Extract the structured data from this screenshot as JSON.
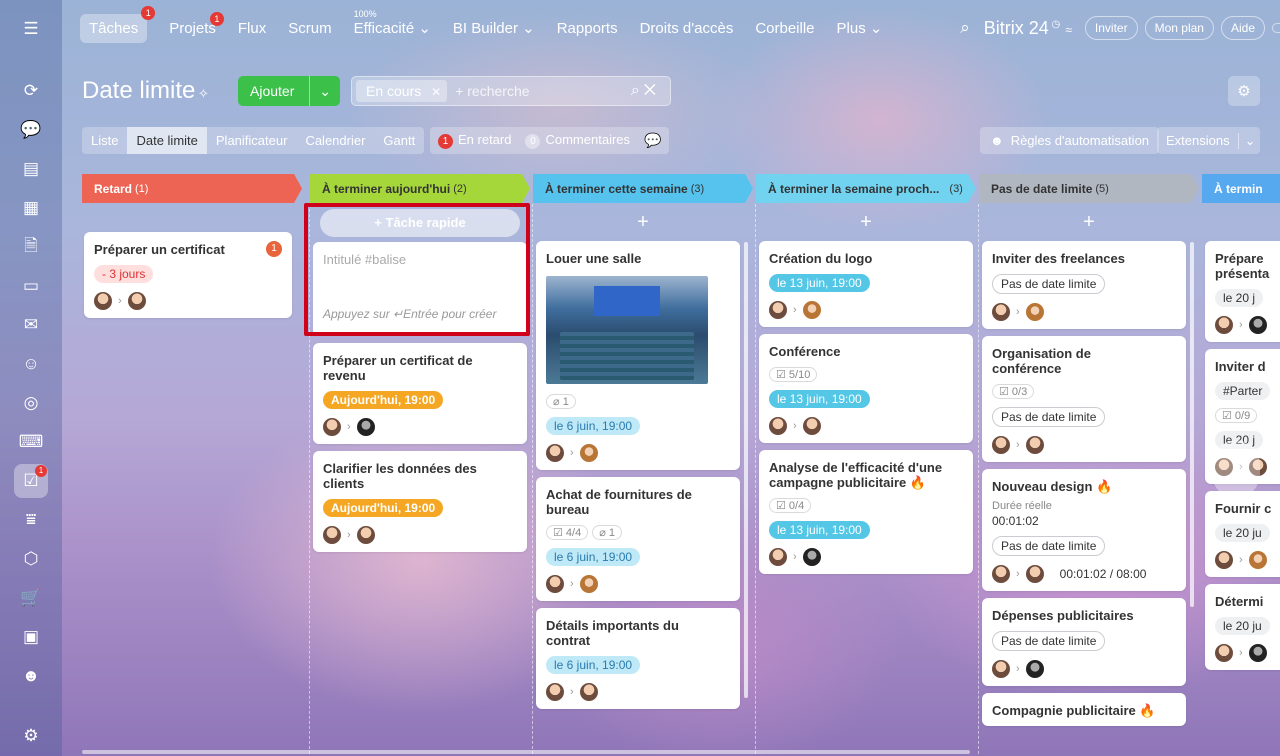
{
  "colors": {
    "accent_green": "#3bc04a",
    "overdue": "#ee6454",
    "today": "#a5d63a",
    "week": "#56c3ef",
    "nextweek": "#72d3f0",
    "nodeadline": "#b0b7c0",
    "badge_red": "#e53935",
    "highlight": "#d0021b"
  },
  "sidebar": {
    "icons": [
      "menu-icon",
      "feed-icon",
      "chat-icon",
      "docs-icon",
      "calendar-icon",
      "files-icon",
      "drive-icon",
      "mail-icon",
      "groups-icon",
      "target-icon",
      "crm-icon",
      "tasks-icon",
      "filter-icon",
      "box-icon",
      "cart-icon",
      "contact-icon",
      "robot-icon",
      "settings-icon"
    ],
    "tasks_badge": "1"
  },
  "topnav": {
    "items": [
      {
        "label": "Tâches",
        "badge": "1",
        "active": true
      },
      {
        "label": "Projets",
        "badge": "1"
      },
      {
        "label": "Flux"
      },
      {
        "label": "Scrum"
      },
      {
        "label": "Efficacité",
        "sup": "100%",
        "dropdown": true
      },
      {
        "label": "BI Builder",
        "dropdown": true
      },
      {
        "label": "Rapports"
      },
      {
        "label": "Droits d'accès"
      },
      {
        "label": "Corbeille"
      },
      {
        "label": "Plus",
        "dropdown": true
      }
    ],
    "brand": "Bitrix 24",
    "invite": "Inviter",
    "plan": "Mon plan",
    "help": "Aide"
  },
  "header": {
    "title": "Date limite",
    "add_label": "Ajouter",
    "filter_chip": "En cours",
    "search_placeholder": "+ recherche"
  },
  "views": {
    "items": [
      "Liste",
      "Date limite",
      "Planificateur",
      "Calendrier",
      "Gantt"
    ],
    "active": "Date limite"
  },
  "counters": {
    "overdue_count": "1",
    "overdue_label": "En retard",
    "comments_count": "0",
    "comments_label": "Commentaires"
  },
  "automation": {
    "label": "Règles d'automatisation"
  },
  "extensions": {
    "label": "Extensions"
  },
  "columns": [
    {
      "title": "Retard",
      "count": "(1)",
      "cards": [
        {
          "title": "Préparer un certificat",
          "badge": "1",
          "tag": "- 3 jours"
        }
      ]
    },
    {
      "title": "À terminer aujourd'hui",
      "count": "(2)",
      "quick": "+ Tâche rapide",
      "field": {
        "placeholder": "Intitulé #balise",
        "hint": "Appuyez sur ↵Entrée pour créer"
      },
      "cards": [
        {
          "title": "Préparer un certificat de revenu",
          "tag": "Aujourd'hui, 19:00"
        },
        {
          "title": "Clarifier les données des clients",
          "tag": "Aujourd'hui, 19:00"
        }
      ]
    },
    {
      "title": "À terminer cette semaine",
      "count": "(3)",
      "cards": [
        {
          "title": "Louer une salle",
          "files": "1",
          "tag": "le 6 juin, 19:00"
        },
        {
          "title": "Achat de fournitures de bureau",
          "checklist": "4/4",
          "files": "1",
          "tag": "le 6 juin, 19:00"
        },
        {
          "title": "Détails importants du contrat",
          "tag": "le 6 juin, 19:00"
        }
      ]
    },
    {
      "title": "À terminer la semaine proch...",
      "count": "(3)",
      "cards": [
        {
          "title": "Création du logo",
          "tag": "le 13 juin, 19:00"
        },
        {
          "title": "Conférence",
          "checklist": "5/10",
          "tag": "le 13 juin, 19:00"
        },
        {
          "title": "Analyse de l'efficacité d'une campagne publicitaire",
          "checklist": "0/4",
          "tag": "le 13 juin, 19:00"
        }
      ]
    },
    {
      "title": "Pas de date limite",
      "count": "(5)",
      "cards": [
        {
          "title": "Inviter des freelances",
          "tag": "Pas de date limite"
        },
        {
          "title": "Organisation de conférence",
          "checklist": "0/3",
          "tag": "Pas de date limite"
        },
        {
          "title": "Nouveau design",
          "time_label": "Durée réelle",
          "time_value": "00:01:02",
          "tag": "Pas de date limite",
          "timer": "00:01:02 / 08:00"
        },
        {
          "title": "Dépenses publicitaires",
          "tag": "Pas de date limite"
        },
        {
          "title": "Compagnie publicitaire"
        }
      ]
    },
    {
      "title": "À termin",
      "cards": [
        {
          "title": "Prépare présenta",
          "tag": "le 20 j"
        },
        {
          "title": "Inviter d",
          "tagline": "#Parter",
          "checklist": "0/9",
          "tag": "le 20 j"
        },
        {
          "title": "Fournir c",
          "tag": "le 20 ju"
        },
        {
          "title": "Détermi",
          "tag": "le 20 ju"
        }
      ]
    }
  ]
}
